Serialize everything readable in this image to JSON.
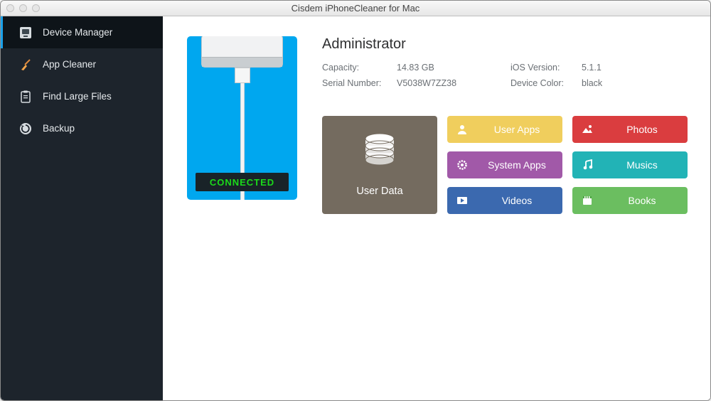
{
  "window": {
    "title": "Cisdem iPhoneCleaner for Mac"
  },
  "sidebar": {
    "items": [
      {
        "label": "Device Manager"
      },
      {
        "label": "App Cleaner"
      },
      {
        "label": "Find Large Files"
      },
      {
        "label": "Backup"
      }
    ]
  },
  "device": {
    "status": "CONNECTED",
    "name": "Administrator",
    "capacity_label": "Capacity:",
    "capacity_value": "14.83 GB",
    "serial_label": "Serial Number:",
    "serial_value": "V5038W7ZZ38",
    "ios_label": "iOS Version:",
    "ios_value": "5.1.1",
    "color_label": "Device Color:",
    "color_value": "black"
  },
  "tiles": {
    "userdata": "User Data",
    "user_apps": "User Apps",
    "photos": "Photos",
    "system_apps": "System Apps",
    "musics": "Musics",
    "videos": "Videos",
    "books": "Books"
  }
}
